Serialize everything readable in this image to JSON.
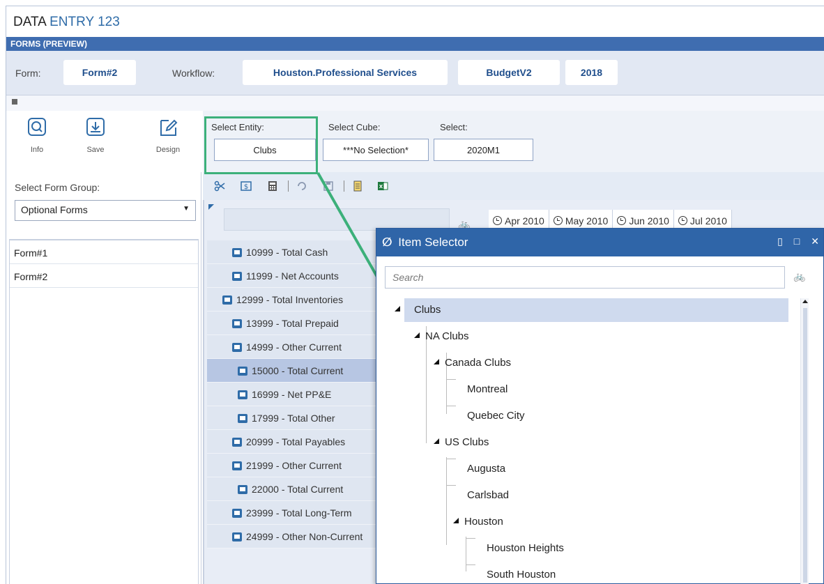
{
  "app": {
    "title_bold": "DATA",
    "title_rest": "ENTRY 123",
    "section": "FORMS (PREVIEW)"
  },
  "header": {
    "form_label": "Form:",
    "form_value": "Form#2",
    "workflow_label": "Workflow:",
    "workflow_value": "Houston.Professional Services",
    "scenario": "BudgetV2",
    "year": "2018"
  },
  "toolbar": {
    "info": "Info",
    "save": "Save",
    "design": "Design"
  },
  "left": {
    "group_label": "Select Form Group:",
    "group_value": "Optional Forms",
    "forms": [
      "Form#1",
      "Form#2"
    ]
  },
  "selectors": {
    "entity_label": "Select Entity:",
    "entity_value": "Clubs",
    "cube_label": "Select Cube:",
    "cube_value": "***No Selection*",
    "time_label": "Select:",
    "time_value": "2020M1"
  },
  "grid": {
    "periods": [
      "Apr 2010",
      "May 2010",
      "Jun 2010",
      "Jul 2010"
    ],
    "accounts": [
      "10999 - Total Cash",
      "11999 - Net Accounts",
      "12999 - Total Inventories",
      "13999 - Total Prepaid",
      "14999 - Other Current",
      "15000 - Total Current",
      "16999 - Net PP&E",
      "17999 - Total Other",
      "20999 - Total Payables",
      "21999 - Other Current",
      "22000 - Total Current",
      "23999 - Total Long-Term",
      "24999 - Other Non-Current"
    ]
  },
  "dialog": {
    "title": "Item Selector",
    "search_placeholder": "Search",
    "tree": {
      "root": "Clubs",
      "na": "NA Clubs",
      "canada": "Canada Clubs",
      "montreal": "Montreal",
      "quebec": "Quebec City",
      "us": "US Clubs",
      "augusta": "Augusta",
      "carlsbad": "Carlsbad",
      "houston": "Houston",
      "heights": "Houston Heights",
      "south": "South Houston"
    }
  },
  "colors": {
    "accent": "#2f65a8",
    "highlight": "#3cb07a",
    "selected_row": "#b7c6e3"
  }
}
